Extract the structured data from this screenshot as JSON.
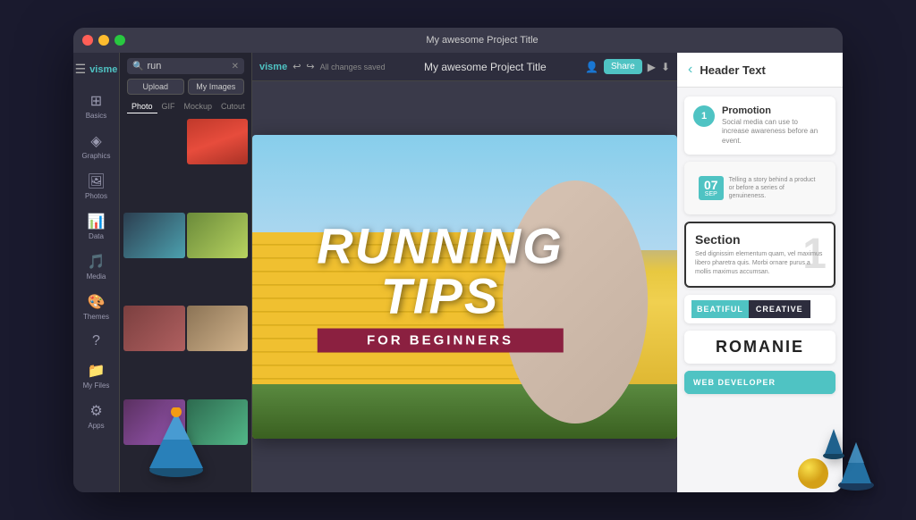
{
  "titlebar": {
    "title": "My awesome Project Title",
    "dots": [
      "red",
      "yellow",
      "green"
    ]
  },
  "toolbar": {
    "logo": "visme",
    "undo_icon": "↩",
    "redo_icon": "↪",
    "saved_text": "All changes saved",
    "project_title": "My awesome Project Title",
    "share_label": "Share",
    "play_icon": "▶",
    "download_icon": "⬇"
  },
  "left_sidebar": {
    "items": [
      {
        "icon": "⊞",
        "label": "Basics"
      },
      {
        "icon": "◈",
        "label": "Graphics"
      },
      {
        "icon": "🖼",
        "label": "Photos"
      },
      {
        "icon": "📊",
        "label": "Data"
      },
      {
        "icon": "🎵",
        "label": "Media"
      },
      {
        "icon": "🎨",
        "label": "Themes"
      },
      {
        "icon": "?",
        "label": ""
      },
      {
        "icon": "📁",
        "label": "My Files"
      },
      {
        "icon": "⚙",
        "label": "Apps"
      }
    ]
  },
  "media_panel": {
    "search_placeholder": "run",
    "search_value": "run",
    "upload_label": "Upload",
    "my_images_label": "My Images",
    "tabs": [
      "Photo",
      "GIF",
      "Mockup",
      "Cutout"
    ],
    "active_tab": "Photo",
    "images": [
      {
        "id": "crowd",
        "alt": "crowd running"
      },
      {
        "id": "track",
        "alt": "running track"
      },
      {
        "id": "road",
        "alt": "road runner"
      },
      {
        "id": "stadium",
        "alt": "stadium"
      },
      {
        "id": "sprint",
        "alt": "sprint"
      },
      {
        "id": "dog",
        "alt": "dog running"
      },
      {
        "id": "woman",
        "alt": "woman running"
      },
      {
        "id": "run2",
        "alt": "runner 2"
      }
    ]
  },
  "slide": {
    "title_line1": "RUNNING",
    "title_line2": "TIPS",
    "subtitle": "FOR BEGINNERS"
  },
  "right_panel": {
    "back_icon": "‹",
    "title": "Header Text",
    "templates": [
      {
        "id": "promotion",
        "number": "1",
        "label": "Promotion",
        "description": "Social media can use to increase awareness before an event."
      },
      {
        "id": "date",
        "date_num": "07",
        "date_month": "SEP",
        "description": "Telling a story behind a product or before a series of genuineness."
      },
      {
        "id": "section",
        "title": "Section",
        "number": "1",
        "description": "Sed dignissim elementum quam, vel maximus libero pharetra quis. Morbi ornare purus a mollis maximus accumsan."
      },
      {
        "id": "creative",
        "light_text": "BEATIFUL",
        "dark_text": "CREATIVE"
      },
      {
        "id": "romanie",
        "text": "ROMANIE"
      },
      {
        "id": "webdev",
        "text": "WEB DEVELOPER"
      }
    ]
  }
}
